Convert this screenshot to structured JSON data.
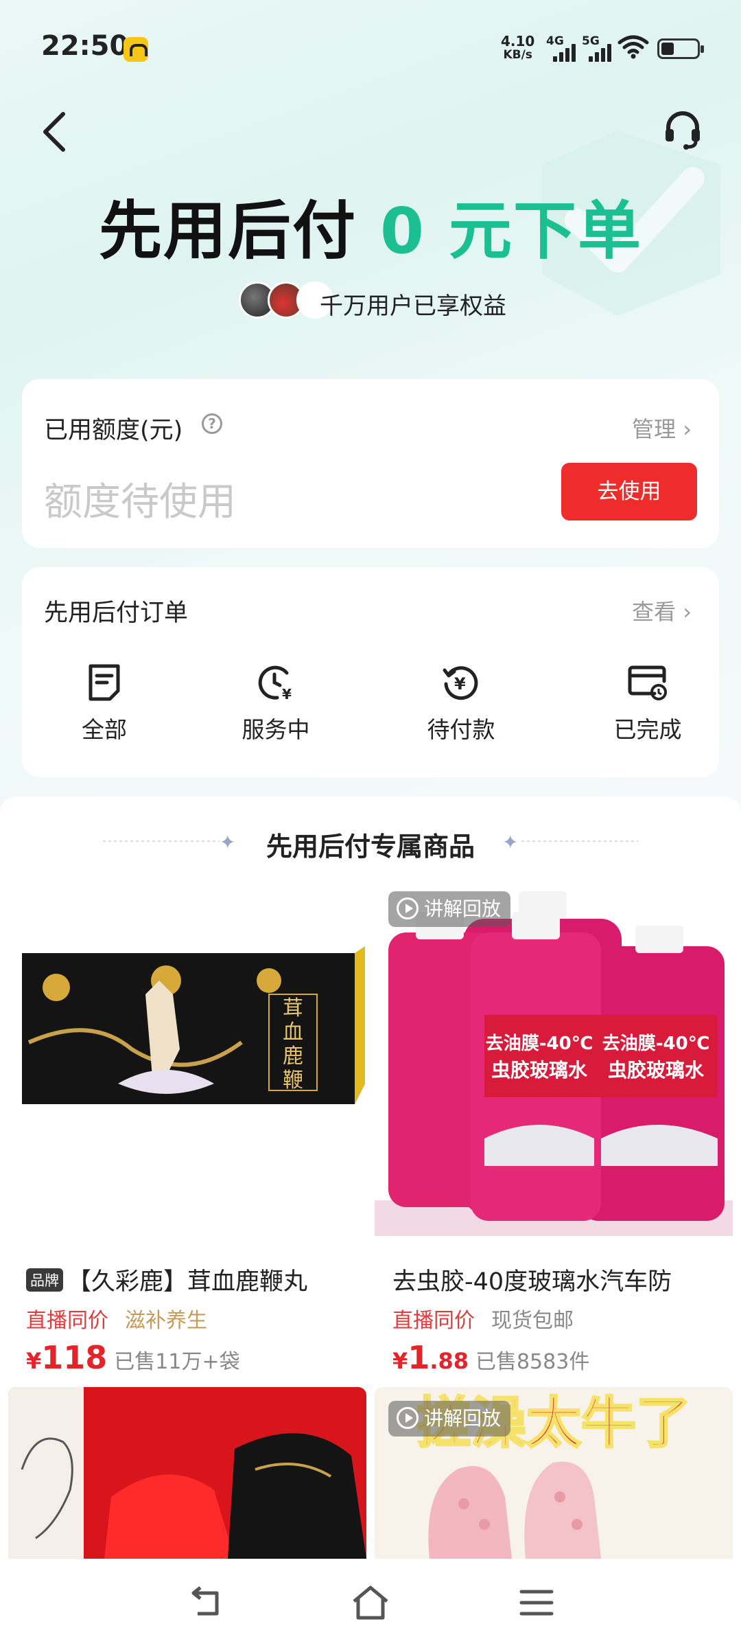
{
  "status_bar": {
    "time": "22:50",
    "net_speed_value": "4.10",
    "net_speed_unit": "KB/s",
    "sim1": "4G",
    "sim2": "5G"
  },
  "header": {
    "back_icon": "chevron-left-icon",
    "support_icon": "headset-icon"
  },
  "hero": {
    "title_main": "先用后付",
    "title_accent": "0 元下单",
    "users_text": "千万用户已享权益"
  },
  "credit": {
    "title": "已用额度(元)",
    "help_icon": "?",
    "manage_label": "管理 ›",
    "value_placeholder": "额度待使用",
    "use_button": "去使用"
  },
  "orders": {
    "title": "先用后付订单",
    "view_label": "查看 ›",
    "tabs": [
      {
        "label": "全部",
        "icon": "document-icon"
      },
      {
        "label": "服务中",
        "icon": "clock-yen-icon"
      },
      {
        "label": "待付款",
        "icon": "yen-refresh-icon"
      },
      {
        "label": "已完成",
        "icon": "card-done-icon"
      }
    ]
  },
  "products": {
    "section_title": "先用后付专属商品",
    "items": [
      {
        "brand_tag": "品牌",
        "name": "【久彩鹿】茸血鹿鞭丸",
        "tag1": "直播同价",
        "tag2": "滋补养生",
        "currency": "¥",
        "price_int": "118",
        "price_dec": "",
        "sold": "已售11万+袋",
        "box_text": "茸血鹿鞭丸"
      },
      {
        "replay_badge": "讲解回放",
        "name": "去虫胶-40度玻璃水汽车防",
        "tag1": "直播同价",
        "tag2": "现货包邮",
        "currency": "¥",
        "price_int": "1",
        "price_dec": ".88",
        "sold": "已售8583件",
        "bottle_label_1": "去油膜-40℃",
        "bottle_label_2": "虫胶玻璃水"
      },
      {
        "image": "red-sneakers"
      },
      {
        "replay_badge": "讲解回放",
        "banner_text": "搓澡太牛了"
      }
    ]
  },
  "nav": {
    "back": "back-icon",
    "home": "home-icon",
    "menu": "menu-icon"
  }
}
